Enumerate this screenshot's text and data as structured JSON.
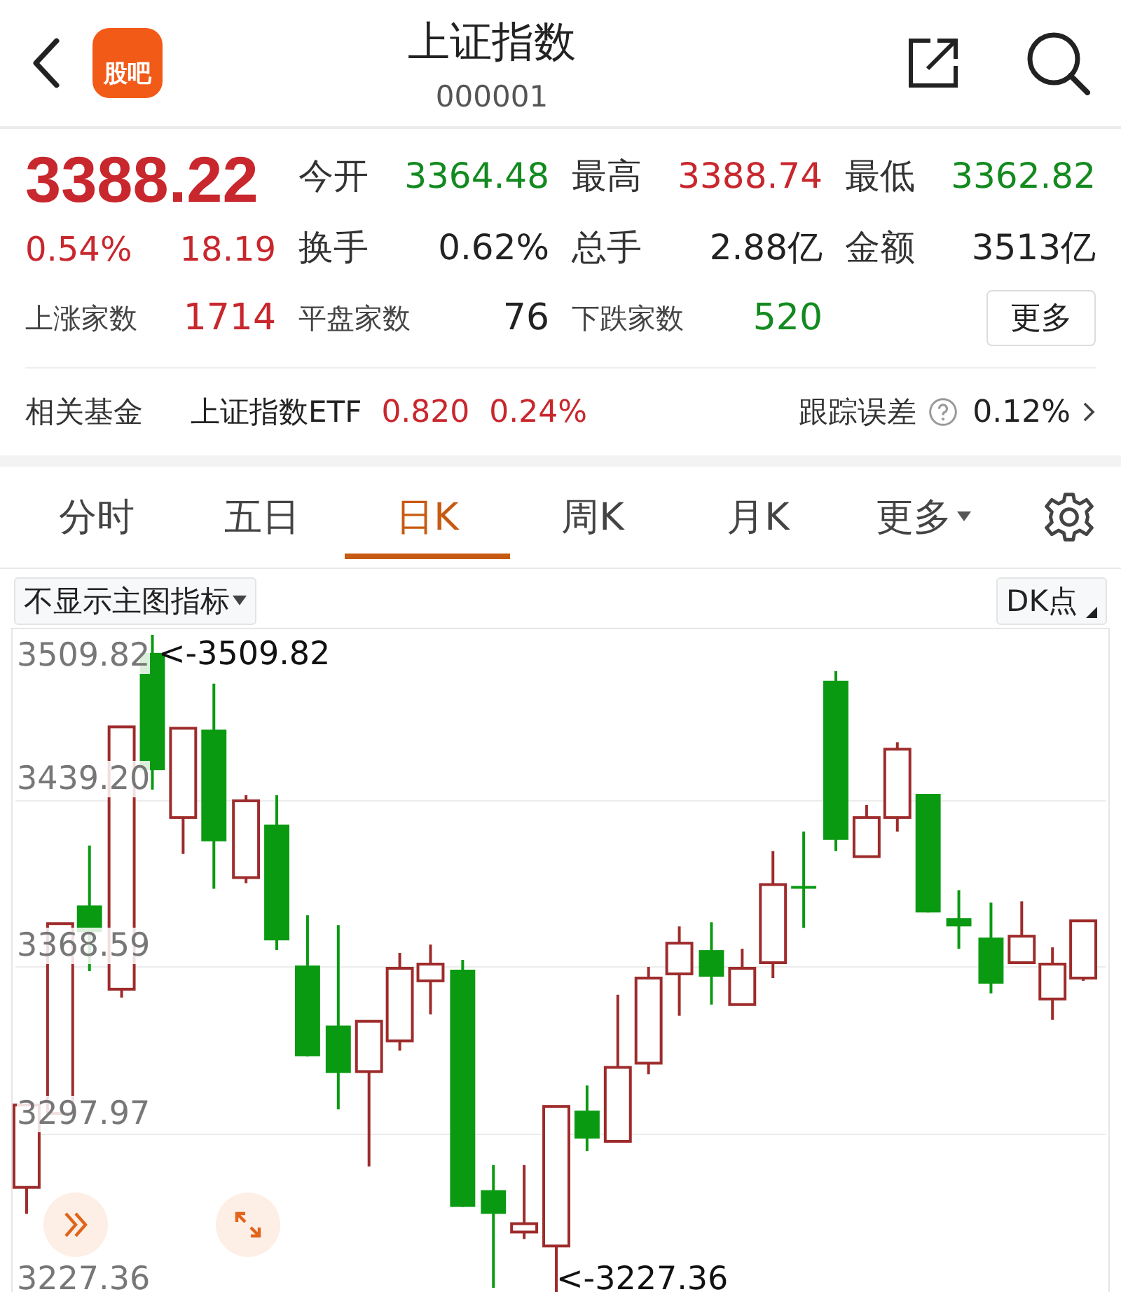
{
  "header": {
    "app_badge": "股吧",
    "title": "上证指数",
    "code": "000001"
  },
  "quote": {
    "price": "3388.22",
    "change_pct": "0.54%",
    "change": "18.19",
    "color": "#c8272d",
    "stats": [
      {
        "label": "今开",
        "value": "3364.48",
        "color": "#138a1f"
      },
      {
        "label": "最高",
        "value": "3388.74",
        "color": "#c8272d"
      },
      {
        "label": "最低",
        "value": "3362.82",
        "color": "#138a1f"
      },
      {
        "label": "换手",
        "value": "0.62%",
        "color": "#222222"
      },
      {
        "label": "总手",
        "value": "2.88亿",
        "color": "#222222"
      },
      {
        "label": "金额",
        "value": "3513亿",
        "color": "#222222"
      }
    ],
    "breadth": [
      {
        "label": "上涨家数",
        "value": "1714",
        "color": "#c8272d"
      },
      {
        "label": "平盘家数",
        "value": "76",
        "color": "#222222"
      },
      {
        "label": "下跌家数",
        "value": "520",
        "color": "#138a1f"
      }
    ],
    "more_button": "更多"
  },
  "fund": {
    "label": "相关基金",
    "name": "上证指数ETF",
    "price": "0.820",
    "pct": "0.24%",
    "color": "#c8272d",
    "tracking_label": "跟踪误差",
    "tracking_value": "0.12%"
  },
  "tabs": [
    {
      "label": "分时",
      "selected": false
    },
    {
      "label": "五日",
      "selected": false
    },
    {
      "label": "日K",
      "selected": true
    },
    {
      "label": "周K",
      "selected": false
    },
    {
      "label": "月K",
      "selected": false
    },
    {
      "label": "更多",
      "selected": false,
      "dropdown": true
    }
  ],
  "indicator_select": "不显示主图指标",
  "dk_button": "DK点",
  "chart": {
    "y_labels": [
      "3509.82",
      "3439.20",
      "3368.59",
      "3297.97",
      "3227.36"
    ],
    "max_marker": "<-3509.82",
    "min_marker": "<-3227.36"
  }
}
